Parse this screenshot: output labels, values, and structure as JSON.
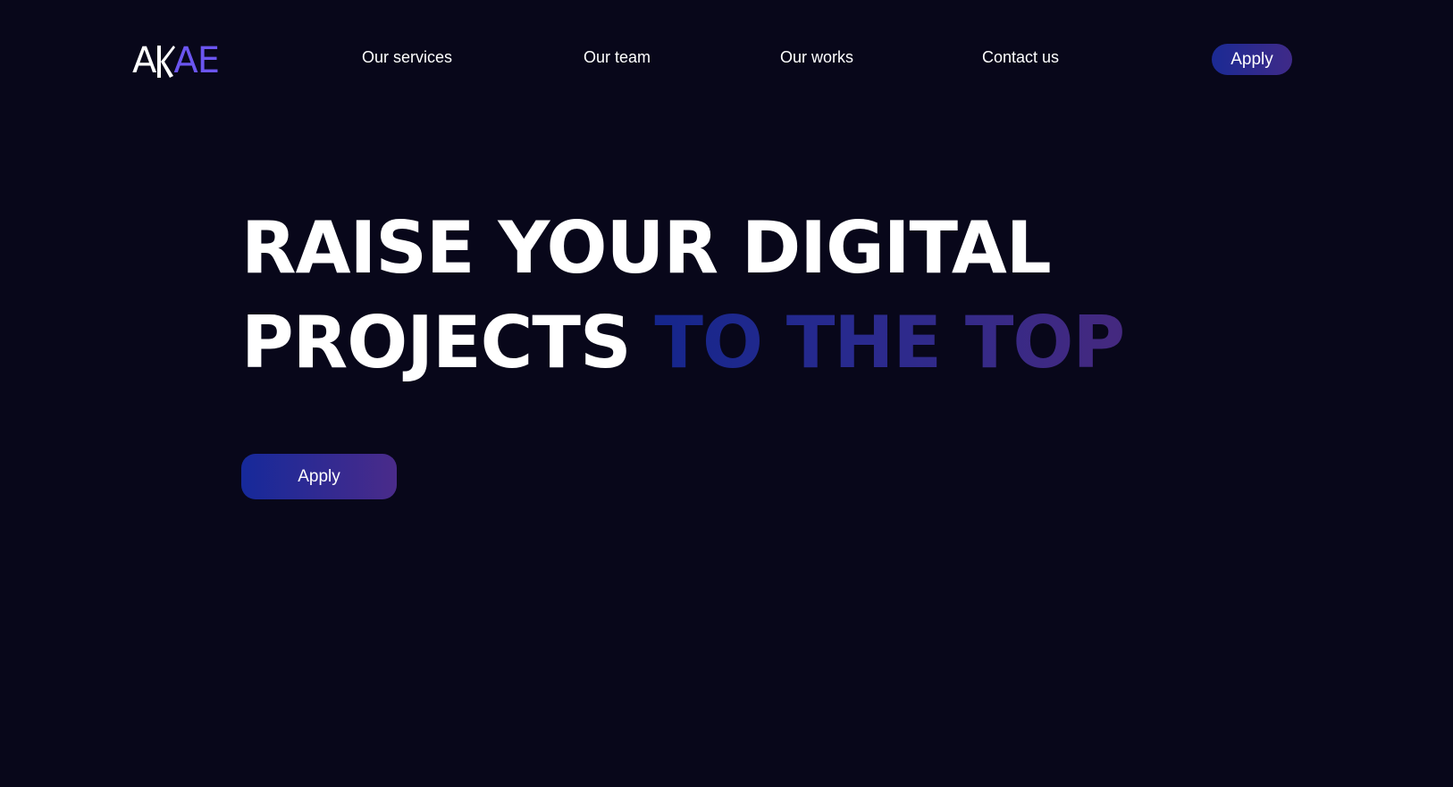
{
  "brand": {
    "logo_letter_1": "A",
    "logo_letter_2": "K",
    "logo_accent": "AE",
    "accent_color": "#6b55f0"
  },
  "nav": {
    "links": [
      {
        "label": "Our services"
      },
      {
        "label": "Our team"
      },
      {
        "label": "Our works"
      },
      {
        "label": "Contact us"
      }
    ],
    "apply_label": "Apply"
  },
  "hero": {
    "line1": "RAISE YOUR DIGITAL",
    "line2_plain": "PROJECTS ",
    "line2_accent": "TO THE TOP",
    "apply_label": "Apply"
  },
  "colors": {
    "background": "#08071a",
    "gradient_start": "#16299a",
    "gradient_end": "#4a2b8a"
  }
}
